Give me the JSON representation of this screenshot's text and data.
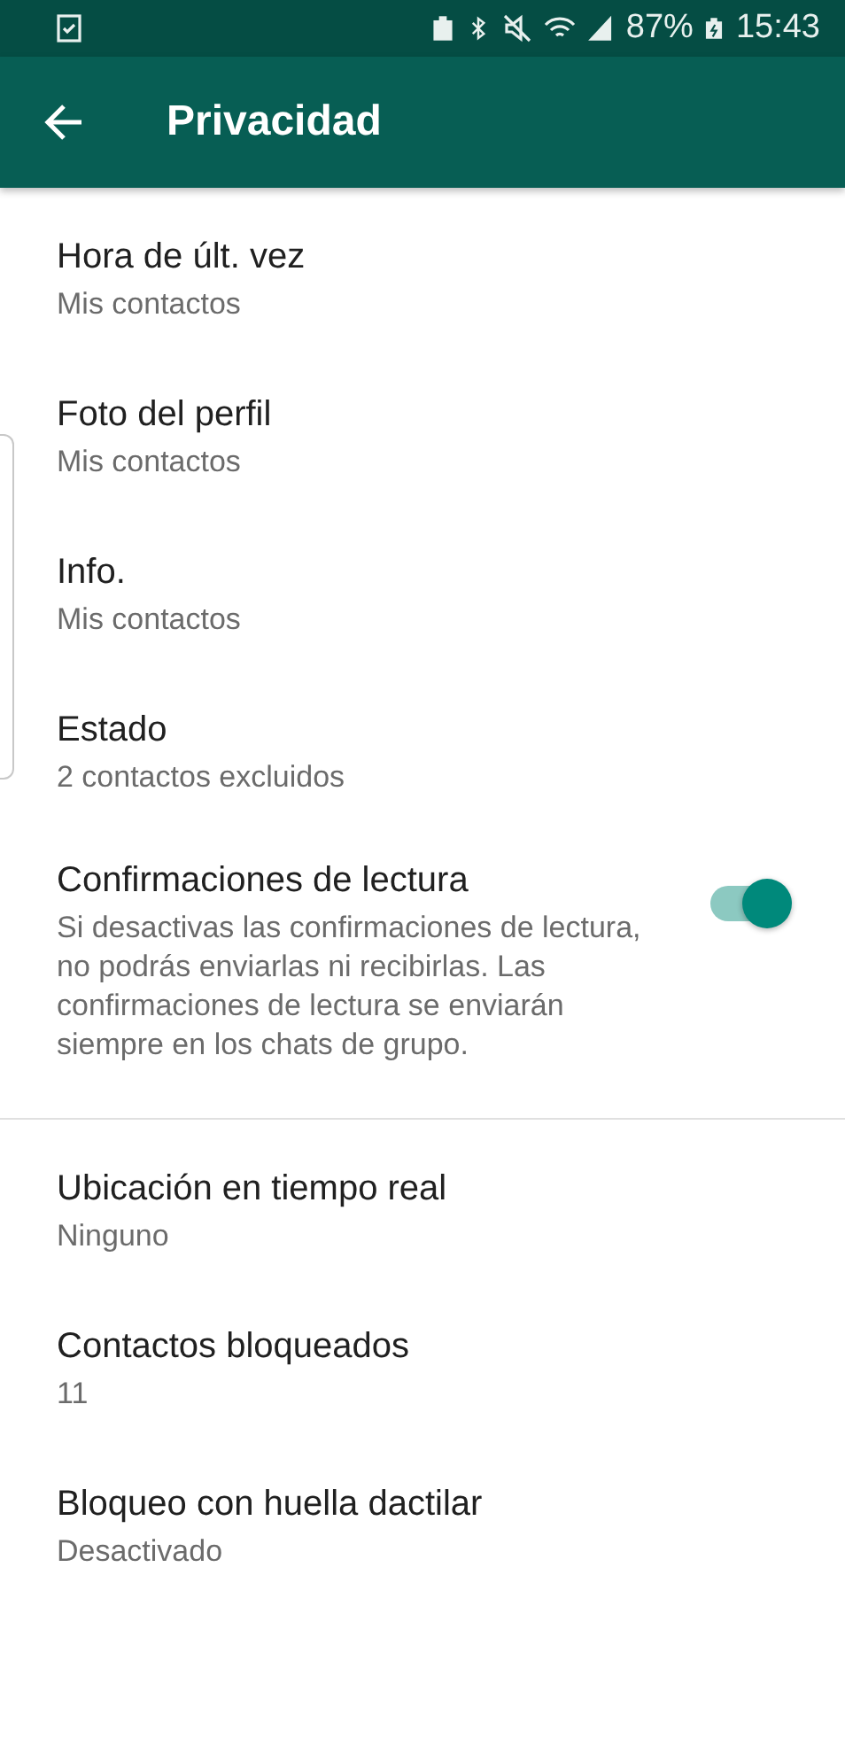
{
  "status_bar": {
    "battery": "87%",
    "time": "15:43"
  },
  "app_bar": {
    "title": "Privacidad"
  },
  "sections": [
    {
      "items": [
        {
          "kind": "setting",
          "title": "Hora de últ. vez",
          "subtitle": "Mis contactos"
        },
        {
          "kind": "setting",
          "title": "Foto del perfil",
          "subtitle": "Mis contactos"
        },
        {
          "kind": "setting",
          "title": "Info.",
          "subtitle": "Mis contactos"
        },
        {
          "kind": "setting",
          "title": "Estado",
          "subtitle": "2 contactos excluidos"
        },
        {
          "kind": "toggle",
          "title": "Confirmaciones de lectura",
          "subtitle": "Si desactivas las confirmaciones de lectura, no podrás enviarlas ni recibirlas. Las confirmaciones de lectura se enviarán siempre en los chats de grupo.",
          "on": true
        }
      ]
    },
    {
      "items": [
        {
          "kind": "setting",
          "title": "Ubicación en tiempo real",
          "subtitle": "Ninguno"
        },
        {
          "kind": "setting",
          "title": "Contactos bloqueados",
          "subtitle": "11"
        },
        {
          "kind": "setting",
          "title": "Bloqueo con huella dactilar",
          "subtitle": "Desactivado"
        }
      ]
    }
  ]
}
